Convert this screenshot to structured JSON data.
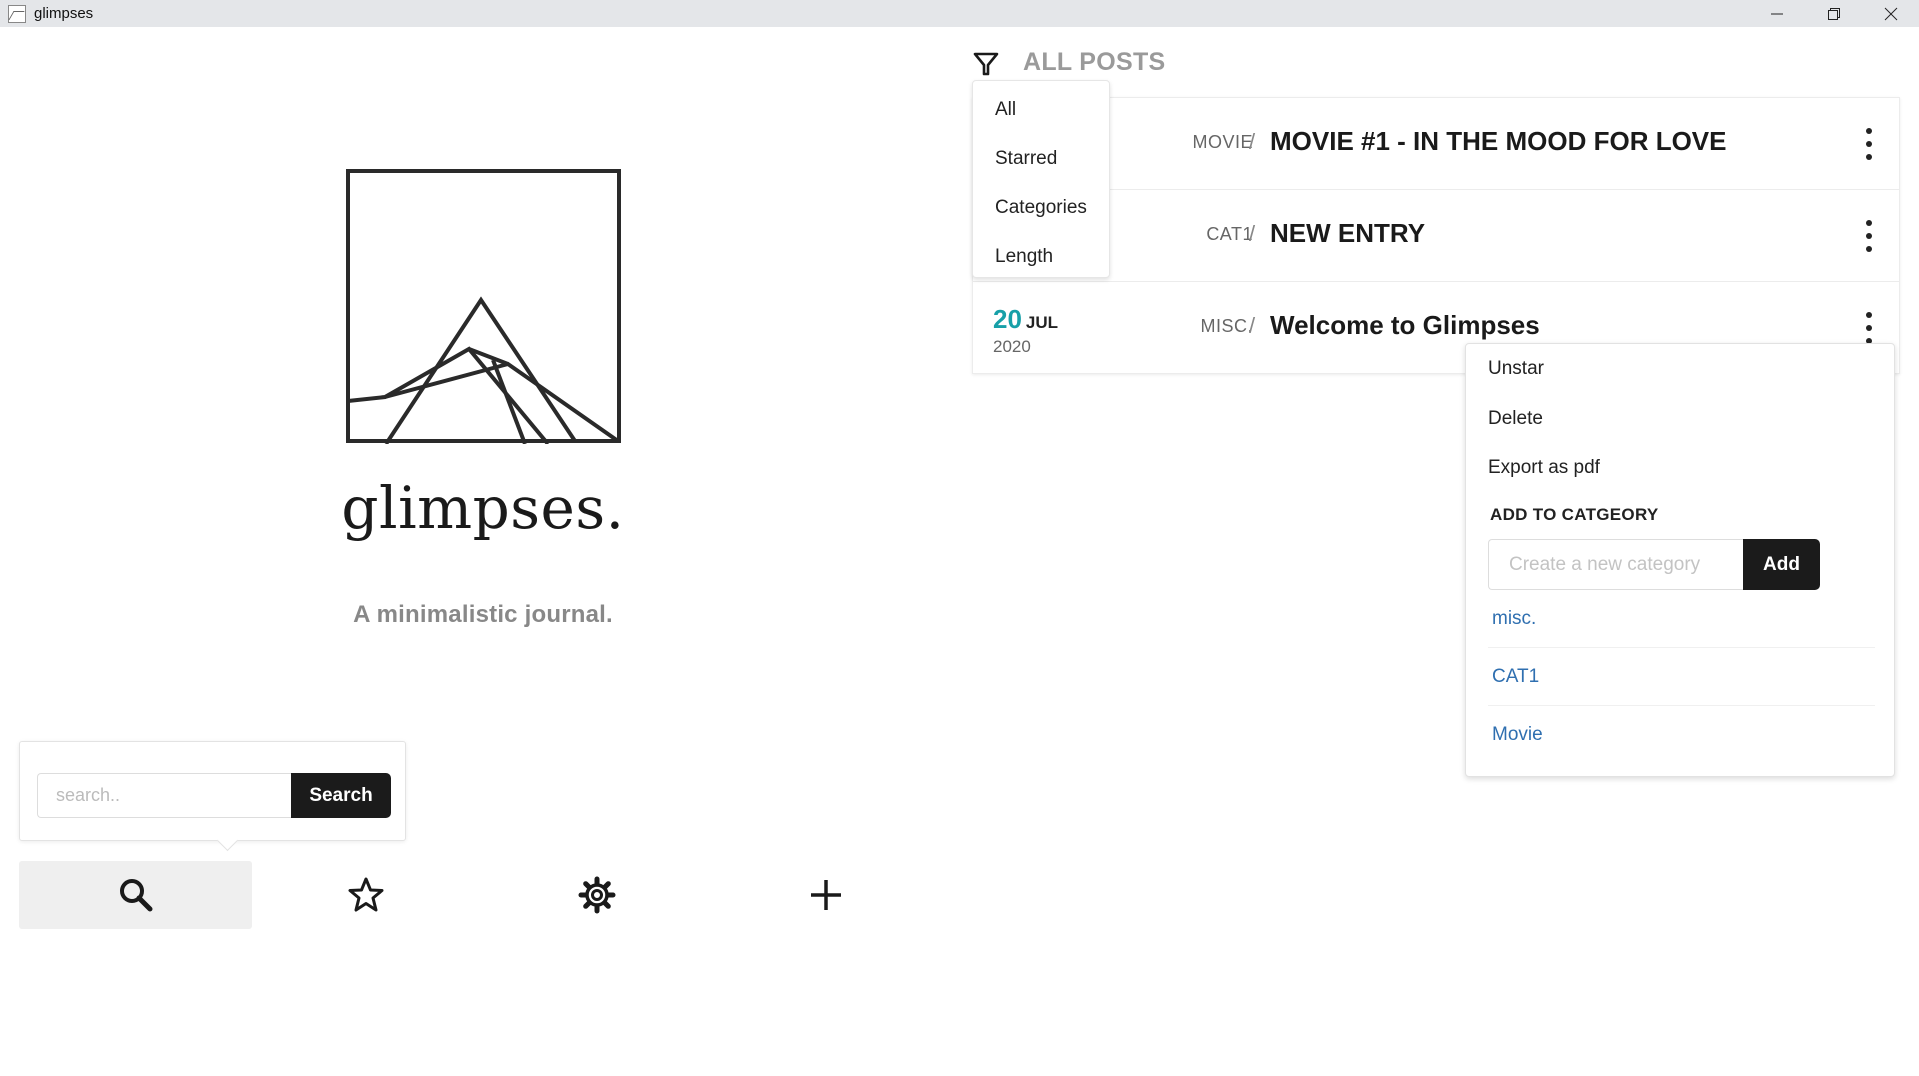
{
  "window": {
    "title": "glimpses",
    "controls": [
      "minimize",
      "maximize",
      "close"
    ]
  },
  "hero": {
    "brand": "glimpses.",
    "tagline": "A minimalistic journal."
  },
  "search": {
    "placeholder": "search..",
    "button": "Search"
  },
  "nav": {
    "items": [
      {
        "name": "search",
        "icon": "search-icon",
        "active": true
      },
      {
        "name": "starred",
        "icon": "star-icon",
        "active": false
      },
      {
        "name": "settings",
        "icon": "gear-icon",
        "active": false
      },
      {
        "name": "new",
        "icon": "plus-icon",
        "active": false
      }
    ]
  },
  "filter": {
    "heading": "ALL POSTS",
    "options": [
      "All",
      "Starred",
      "Categories",
      "Length"
    ]
  },
  "posts": [
    {
      "category": "MOVIE",
      "title": "MOVIE #1 - IN THE MOOD FOR LOVE",
      "day": "",
      "month": "",
      "year": ""
    },
    {
      "category": "CAT1",
      "title": "NEW ENTRY",
      "day": "",
      "month": "",
      "year": ""
    },
    {
      "category": "MISC.",
      "title": "Welcome to Glimpses",
      "day": "20",
      "month": "JUL",
      "year": "2020"
    }
  ],
  "separator": "/",
  "context_menu": {
    "items": [
      "Unstar",
      "Delete",
      "Export as pdf"
    ],
    "add_header": "ADD TO CATGEORY",
    "category_placeholder": "Create a new category",
    "add_button": "Add",
    "categories": [
      "misc.",
      "CAT1",
      "Movie"
    ]
  },
  "colors": {
    "accent_date": "#17a0a8",
    "category_link": "#2f6fb0",
    "button_dark": "#1b1b1b"
  }
}
